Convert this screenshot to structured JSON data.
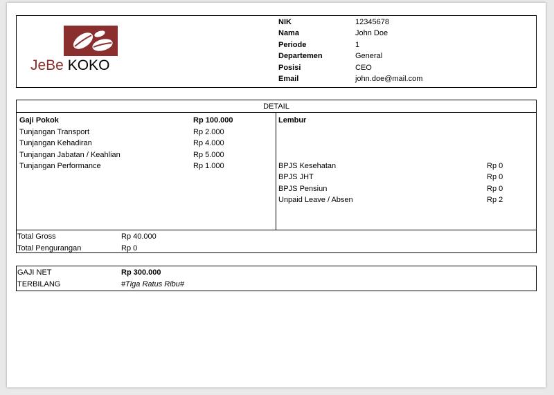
{
  "header": {
    "logo": {
      "text_part1": "JeBe",
      "text_part2": "KOKO",
      "brand_color": "#8b2e2e"
    },
    "info": [
      {
        "label": "NIK",
        "value": "12345678"
      },
      {
        "label": "Nama",
        "value": "John Doe"
      },
      {
        "label": "Periode",
        "value": "1"
      },
      {
        "label": "Departemen",
        "value": "General"
      },
      {
        "label": "Posisi",
        "value": "CEO"
      },
      {
        "label": "Email",
        "value": "john.doe@mail.com"
      }
    ]
  },
  "detail": {
    "title": "DETAIL",
    "left": [
      {
        "label": "Gaji Pokok",
        "value": "Rp 100.000"
      },
      {
        "label": "Tunjangan Transport",
        "value": "Rp 2.000"
      },
      {
        "label": "Tunjangan Kehadiran",
        "value": "Rp 4.000"
      },
      {
        "label": "Tunjangan Jabatan / Keahlian",
        "value": "Rp 5.000"
      },
      {
        "label": "Tunjangan Performance",
        "value": "Rp 1.000"
      }
    ],
    "lembur_label": "Lembur",
    "deductions": [
      {
        "label": "BPJS Kesehatan",
        "value": "Rp 0"
      },
      {
        "label": "BPJS JHT",
        "value": "Rp 0"
      },
      {
        "label": "BPJS Pensiun",
        "value": "Rp 0"
      },
      {
        "label": "Unpaid Leave / Absen",
        "value": "Rp 2"
      }
    ],
    "totals": [
      {
        "label": "Total Gross",
        "value": "Rp 40.000"
      },
      {
        "label": "Total Pengurangan",
        "value": "Rp 0"
      }
    ]
  },
  "net": {
    "label": "GAJI NET",
    "value": "Rp 300.000",
    "words_label": "TERBILANG",
    "words_value": "#Tiga Ratus Ribu#"
  }
}
